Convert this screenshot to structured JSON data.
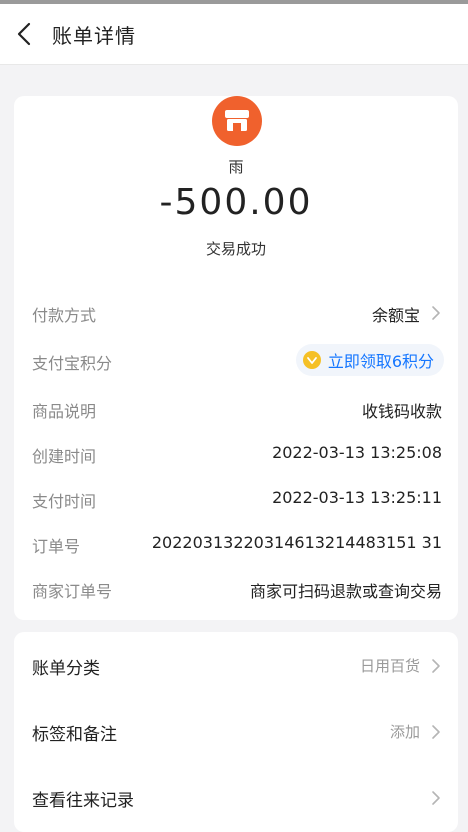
{
  "header": {
    "title": "账单详情"
  },
  "summary": {
    "merchant": "雨",
    "amount": "-500.00",
    "status": "交易成功"
  },
  "details": [
    {
      "label": "付款方式",
      "value": "余额宝"
    },
    {
      "label": "支付宝积分",
      "value": "立即领取6积分"
    },
    {
      "label": "商品说明",
      "value": "收钱码收款"
    },
    {
      "label": "创建时间",
      "value": "2022-03-13 13:25:08"
    },
    {
      "label": "支付时间",
      "value": "2022-03-13 13:25:11"
    },
    {
      "label": "订单号",
      "value": "20220313220314613214483151 31"
    },
    {
      "label": "商家订单号",
      "value": "商家可扫码退款或查询交易"
    }
  ],
  "options": [
    {
      "label": "账单分类",
      "value": "日用百货"
    },
    {
      "label": "标签和备注",
      "value": "添加"
    },
    {
      "label": "查看往来记录",
      "value": ""
    }
  ],
  "colors": {
    "accent": "#1677ff",
    "brand_orange": "#f0612d"
  }
}
